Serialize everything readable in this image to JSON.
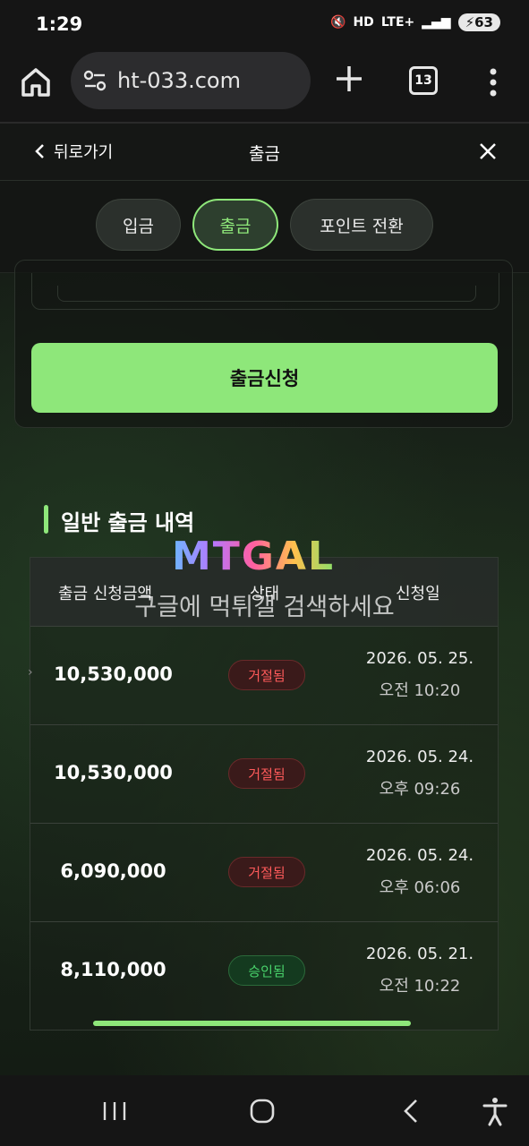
{
  "status_bar": {
    "time": "1:29",
    "network": "LTE+",
    "hd": "HD",
    "battery": "63"
  },
  "browser": {
    "url": "ht-033.com",
    "tab_count": "13"
  },
  "header": {
    "back_label": "뒤로가기",
    "title": "출금"
  },
  "tabs": [
    {
      "label": "입금",
      "active": false
    },
    {
      "label": "출금",
      "active": true
    },
    {
      "label": "포인트 전환",
      "active": false
    }
  ],
  "form": {
    "submit_label": "출금신청"
  },
  "history": {
    "title": "일반 출금 내역",
    "columns": [
      "출금 신청금액",
      "상태",
      "신청일"
    ],
    "rows": [
      {
        "amount": "10,530,000",
        "status": "거절됨",
        "date": "2026. 05. 25.",
        "time": "오전 10:20"
      },
      {
        "amount": "10,530,000",
        "status": "거절됨",
        "date": "2026. 05. 24.",
        "time": "오후 09:26"
      },
      {
        "amount": "6,090,000",
        "status": "거절됨",
        "date": "2026. 05. 24.",
        "time": "오후 06:06"
      },
      {
        "amount": "8,110,000",
        "status": "승인됨",
        "date": "2026. 05. 21.",
        "time": "오전 10:22"
      }
    ]
  },
  "watermark": {
    "logo": "MTGAL",
    "text": "구글에 먹튀갤 검색하세요"
  },
  "colors": {
    "accent": "#8ee77a",
    "reject": "#ff5a5a",
    "approve": "#49d26b"
  }
}
